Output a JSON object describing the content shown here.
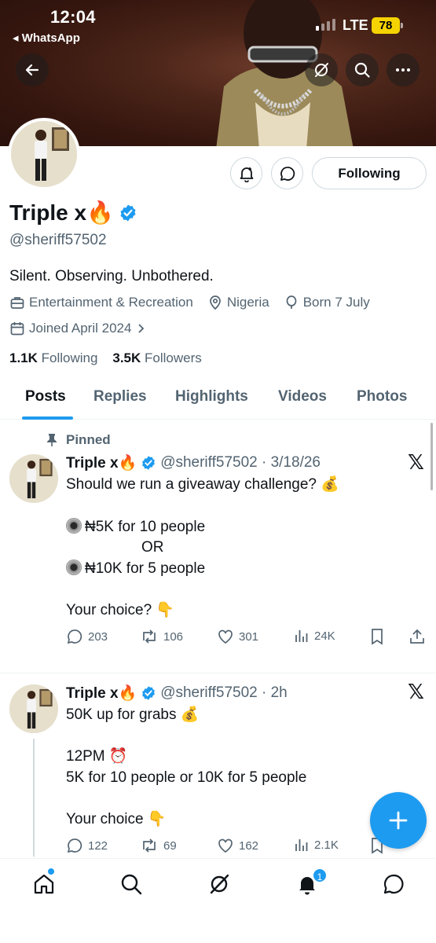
{
  "status_bar": {
    "time": "12:04",
    "back_app": "◂ WhatsApp",
    "network": "LTE",
    "battery": "78"
  },
  "profile": {
    "name": "Triple x🔥",
    "handle": "@sheriff57502",
    "bio": "Silent. Observing. Unbothered.",
    "category": "Entertainment & Recreation",
    "location": "Nigeria",
    "born": "Born 7 July",
    "joined": "Joined April 2024",
    "following_count": "1.1K",
    "following_label": "Following",
    "followers_count": "3.5K",
    "followers_label": "Followers",
    "follow_button": "Following"
  },
  "tabs": [
    "Posts",
    "Replies",
    "Highlights",
    "Videos",
    "Photos"
  ],
  "posts": [
    {
      "pinned_label": "Pinned",
      "author": "Triple x🔥",
      "handle_time": "@sheriff57502 · 3/18/26",
      "lines": [
        "Should we run a giveaway challenge? 💰",
        "₦5K for 10 people",
        "OR",
        "₦10K for 5 people",
        "Your choice? 👇"
      ],
      "replies": "203",
      "reposts": "106",
      "likes": "301",
      "views": "24K"
    },
    {
      "author": "Triple x🔥",
      "handle_time": "@sheriff57502 · 2h",
      "lines": [
        "50K up for grabs 💰",
        "12PM ⏰",
        "5K for 10 people or 10K for 5 people",
        "Your choice 👇"
      ],
      "replies": "122",
      "reposts": "69",
      "likes": "162",
      "views": "2.1K"
    }
  ],
  "bottom_nav": {
    "notifications_badge": "1"
  },
  "colors": {
    "accent": "#1d9bf0",
    "text": "#0f1419",
    "secondary": "#536471"
  }
}
